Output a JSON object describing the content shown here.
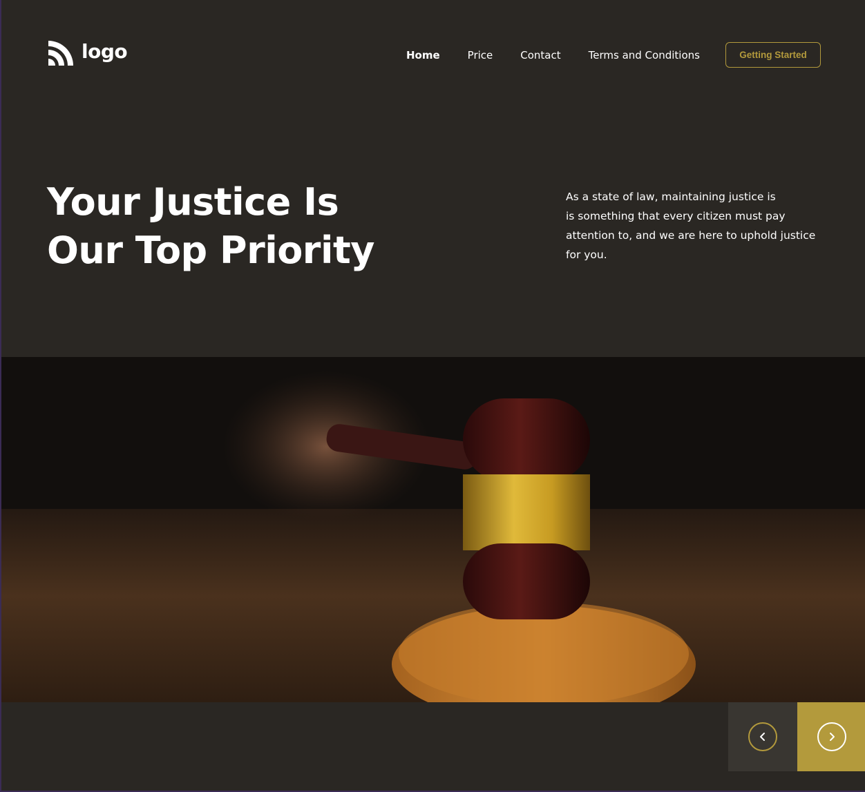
{
  "brand": {
    "logo_text": "logo",
    "logo_icon": "signal-arcs-icon"
  },
  "nav": {
    "items": [
      {
        "label": "Home",
        "active": true
      },
      {
        "label": "Price",
        "active": false
      },
      {
        "label": "Contact",
        "active": false
      },
      {
        "label": "Terms and Conditions",
        "active": false
      }
    ],
    "cta_label": "Getting Started"
  },
  "hero": {
    "title_line1": "Your Justice Is",
    "title_line2": "Our Top Priority",
    "description_line1": "As a state of law, maintaining justice is",
    "description_line2": "is something that every citizen must pay",
    "description_line3": "attention to, and we are here to uphold justice",
    "description_line4": "for you.",
    "image": "judge-gavel-photo"
  },
  "slider": {
    "prev_icon": "chevron-left-icon",
    "next_icon": "chevron-right-icon"
  },
  "colors": {
    "background": "#2a2723",
    "accent": "#b39a3c",
    "control_dark": "#393631",
    "text": "#ffffff"
  }
}
